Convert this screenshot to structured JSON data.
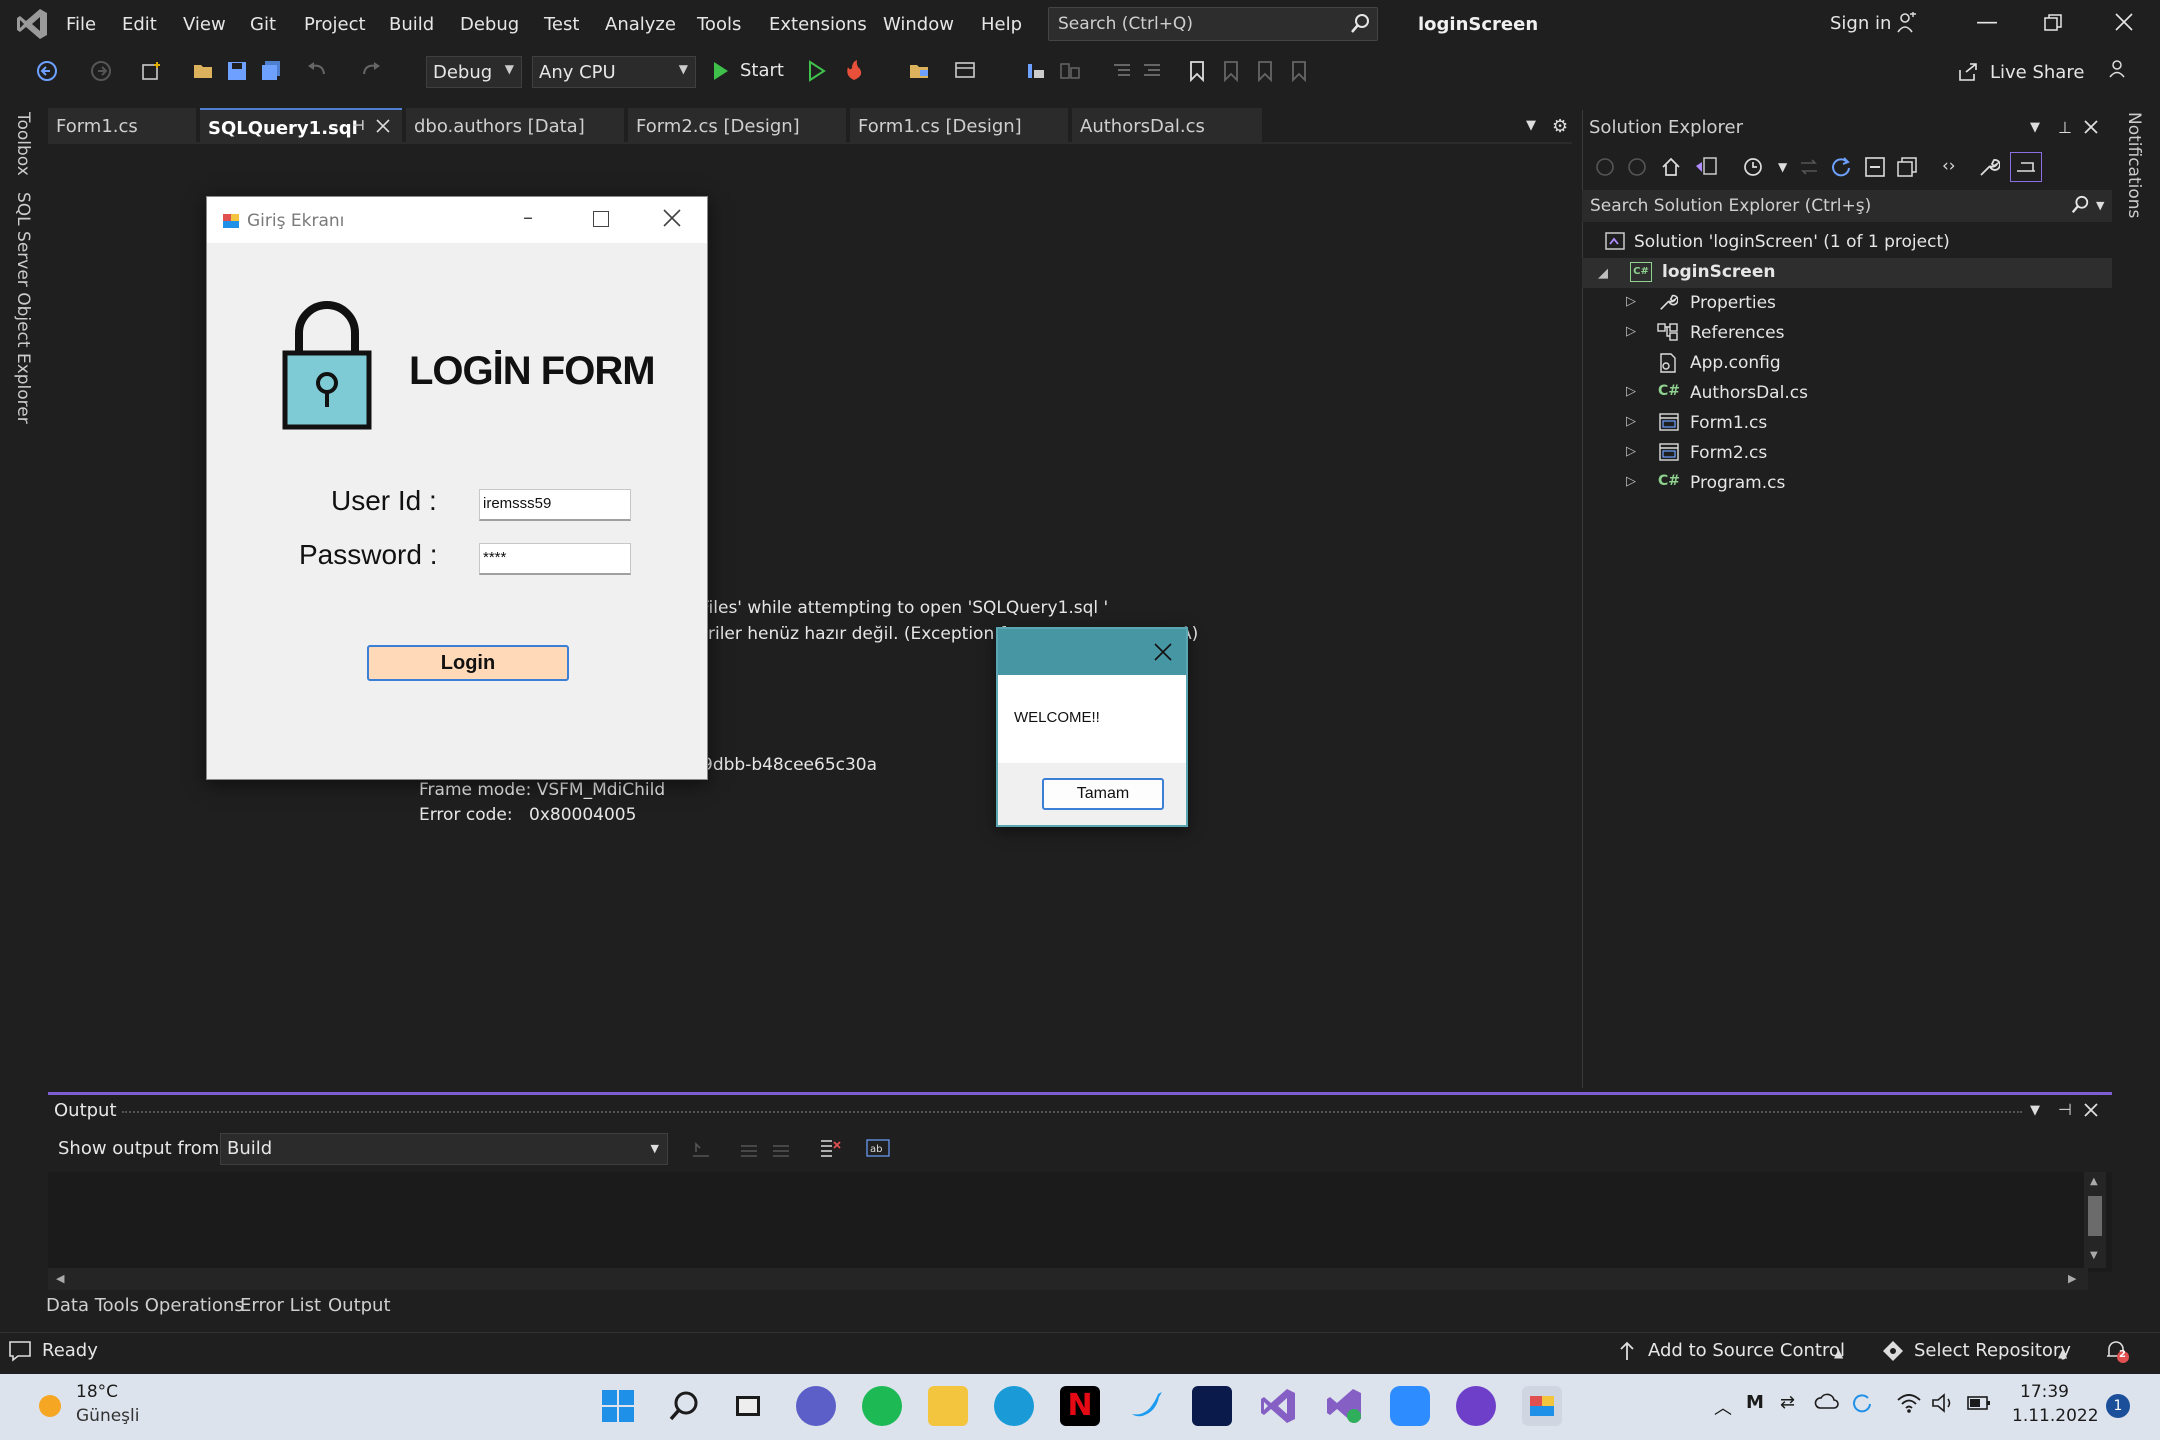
{
  "menubar": {
    "items": [
      "File",
      "Edit",
      "View",
      "Git",
      "Project",
      "Build",
      "Debug",
      "Test",
      "Analyze",
      "Tools",
      "Extensions",
      "Window",
      "Help"
    ],
    "search_placeholder": "Search (Ctrl+Q)",
    "app_title": "loginScreen",
    "sign_in": "Sign in"
  },
  "toolbar": {
    "config": "Debug",
    "platform": "Any CPU",
    "start_label": "Start",
    "live_share": "Live Share"
  },
  "sidebar": {
    "toolbox": "Toolbox",
    "sql_explorer": "SQL Server Object Explorer",
    "notifications": "Notifications"
  },
  "tabs": [
    {
      "label": "Form1.cs"
    },
    {
      "label": "SQLQuery1.sql"
    },
    {
      "label": "dbo.authors [Data]"
    },
    {
      "label": "Form2.cs [Design]"
    },
    {
      "label": "Form1.cs [Design]"
    },
    {
      "label": "AuthorsDal.cs"
    }
  ],
  "editor": {
    "error_line1": "Files' while attempting to open 'SQLQuery1.sql '",
    "error_line2": "riler henüz hazır değil. (Exception fro",
    "error_line2_end": "A)",
    "guid_fragment": "9dbb-b48cee65c30a",
    "frame_mode": "Frame mode: VSFM_MdiChild",
    "error_code_label": "Error code:",
    "error_code": "0x80004005"
  },
  "solution_explorer": {
    "title": "Solution Explorer",
    "search_placeholder": "Search Solution Explorer (Ctrl+ş)",
    "solution": "Solution 'loginScreen' (1 of 1 project)",
    "project": "loginScreen",
    "items": [
      "Properties",
      "References",
      "App.config",
      "AuthorsDal.cs",
      "Form1.cs",
      "Form2.cs",
      "Program.cs"
    ]
  },
  "output": {
    "title": "Output",
    "show_from_label": "Show output from:",
    "source": "Build"
  },
  "bottom_tabs": [
    "Data Tools Operations",
    "Error List",
    "Output"
  ],
  "statusbar": {
    "ready": "Ready",
    "add_source": "Add to Source Control",
    "select_repo": "Select Repository"
  },
  "taskbar": {
    "temperature": "18°C",
    "weather": "Güneşli",
    "time": "17:39",
    "date": "1.11.2022",
    "notification_count": "1",
    "bell_count": "2"
  },
  "login_form": {
    "window_title": "Giriş Ekranı",
    "heading": "LOGİN FORM",
    "userid_label": "User Id :",
    "password_label": "Password :",
    "userid_value": "iremsss59",
    "password_value": "****",
    "login_button": "Login"
  },
  "message_box": {
    "text": "WELCOME!!",
    "ok_button": "Tamam"
  },
  "colors": {
    "accent_purple": "#7b5fd0",
    "msg_title": "#4696a3",
    "login_button_bg": "#ffd9b8",
    "lock_fill": "#7ecbd6"
  }
}
